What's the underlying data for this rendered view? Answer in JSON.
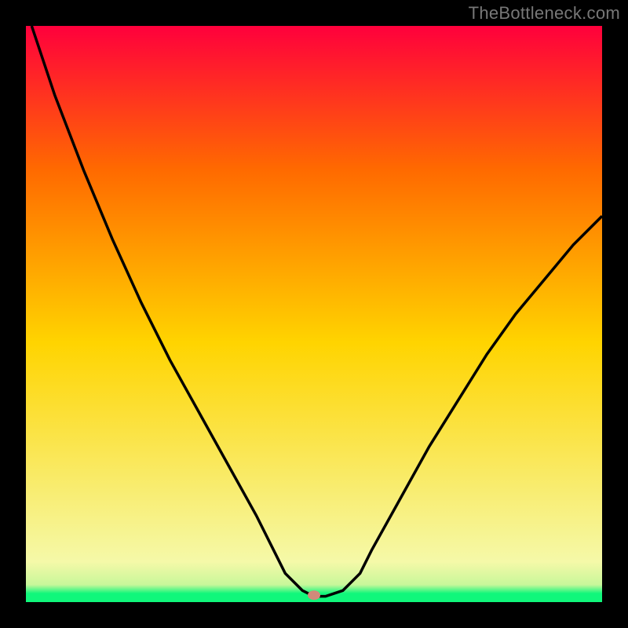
{
  "attribution": "TheBottleneck.com",
  "chart_data": {
    "type": "line",
    "title": "",
    "xlabel": "",
    "ylabel": "",
    "x": [
      0.0,
      0.05,
      0.1,
      0.15,
      0.2,
      0.25,
      0.3,
      0.35,
      0.4,
      0.43,
      0.45,
      0.48,
      0.5,
      0.52,
      0.55,
      0.58,
      0.6,
      0.65,
      0.7,
      0.75,
      0.8,
      0.85,
      0.9,
      0.95,
      1.0
    ],
    "values": [
      1.03,
      0.88,
      0.75,
      0.63,
      0.52,
      0.42,
      0.33,
      0.24,
      0.15,
      0.09,
      0.05,
      0.02,
      0.01,
      0.01,
      0.02,
      0.05,
      0.09,
      0.18,
      0.27,
      0.35,
      0.43,
      0.5,
      0.56,
      0.62,
      0.67
    ],
    "ylim": [
      0,
      1
    ],
    "xlim": [
      0,
      1
    ],
    "marker": {
      "x": 0.5,
      "y": 0.012,
      "color": "#d18a7a"
    },
    "background_gradient": {
      "bottom": "#10f77b",
      "lower": "#f5f9a8",
      "mid": "#ffd400",
      "upper": "#ff6a00",
      "top": "#ff003c"
    }
  },
  "colors": {
    "frame": "#000000",
    "curve": "#000000",
    "marker": "#d18a7a",
    "attribution": "#777777"
  }
}
